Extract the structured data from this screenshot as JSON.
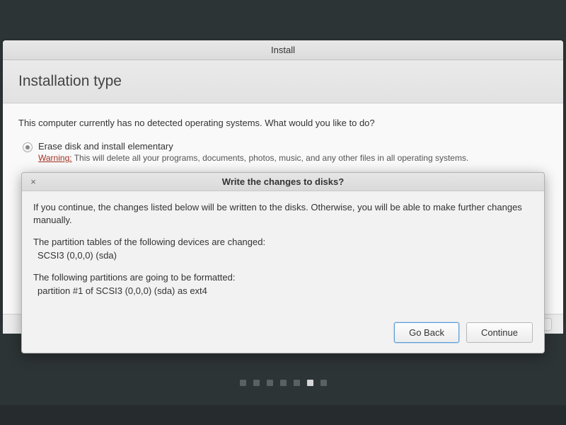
{
  "window": {
    "title": "Install"
  },
  "page": {
    "heading": "Installation type",
    "intro": "This computer currently has no detected operating systems. What would you like to do?",
    "option1": {
      "label": "Erase disk and install elementary",
      "warning_prefix": "Warning:",
      "warning_text": " This will delete all your programs, documents, photos, music, and any other files in all operating systems."
    }
  },
  "dialog": {
    "title": "Write the changes to disks?",
    "line1": "If you continue, the changes listed below will be written to the disks. Otherwise, you will be able to make further changes manually.",
    "line2": "The partition tables of the following devices are changed:",
    "devices": "SCSI3 (0,0,0) (sda)",
    "line3": "The following partitions are going to be formatted:",
    "partitions": "partition #1 of SCSI3 (0,0,0) (sda) as ext4",
    "go_back": "Go Back",
    "continue": "Continue"
  },
  "pager": {
    "total": 7,
    "active": 5
  }
}
